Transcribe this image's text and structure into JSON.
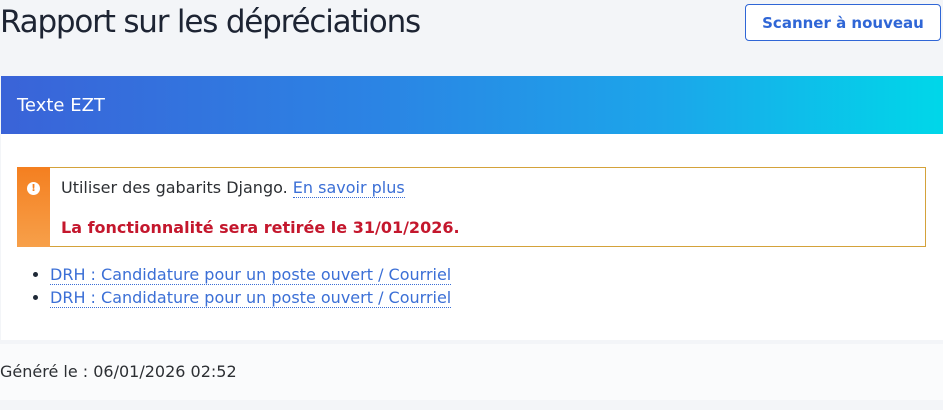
{
  "page": {
    "title": "Rapport sur les dépréciations",
    "rescan_label": "Scanner à nouveau"
  },
  "section": {
    "title": "Texte EZT",
    "warning": {
      "icon": "exclamation-icon",
      "message": "Utiliser des gabarits Django.",
      "link_label": "En savoir plus",
      "deprecation_notice": "La fonctionnalité sera retirée le 31/01/2026."
    },
    "items": [
      {
        "label": "DRH : Candidature pour un poste ouvert / Courriel"
      },
      {
        "label": "DRH : Candidature pour un poste ouvert / Courriel"
      }
    ]
  },
  "footer": {
    "generated": "Généré le : 06/01/2026 02:52"
  },
  "colors": {
    "accent": "#2f66d6",
    "header_gradient_start": "#3a63d8",
    "header_gradient_end": "#00d7e9",
    "warning": "#f47f20",
    "danger": "#c4172d"
  }
}
